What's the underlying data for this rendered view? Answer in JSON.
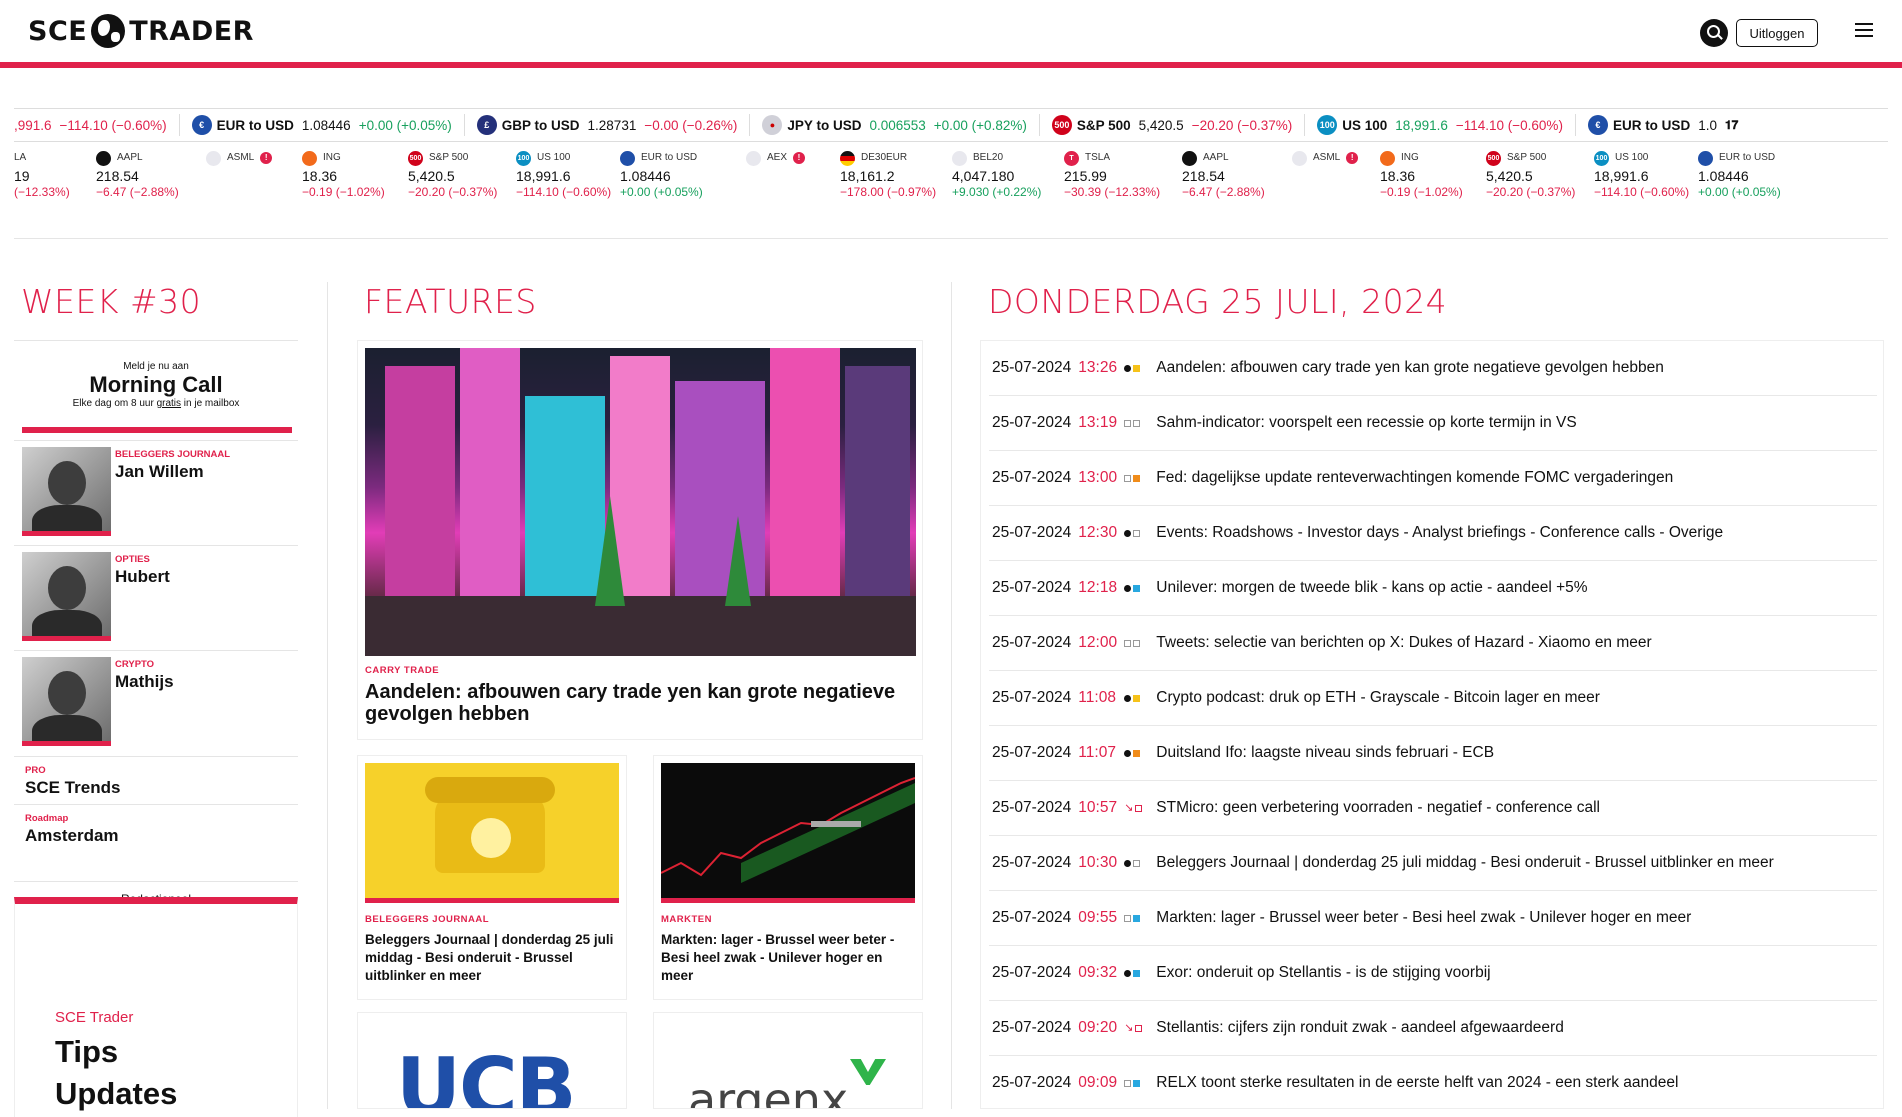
{
  "header": {
    "logo_left": "SCE",
    "logo_right": "TRADER",
    "logout_label": "Uitloggen"
  },
  "ticker_top": [
    {
      "sym": "",
      "price": ",991.6",
      "chg": "−114.10 (−0.60%)",
      "dir": "neg",
      "icon": ""
    },
    {
      "sym": "EUR to USD",
      "price": "1.08446",
      "chg": "+0.00 (+0.05%)",
      "dir": "pos",
      "icon": "flag-eu-us"
    },
    {
      "sym": "GBP to USD",
      "price": "1.28731",
      "chg": "−0.00 (−0.26%)",
      "dir": "neg",
      "icon": "flag-gb-us"
    },
    {
      "sym": "JPY to USD",
      "price": "0.006553",
      "chg": "+0.00 (+0.82%)",
      "dir": "pos",
      "icon": "flag-jp-us"
    },
    {
      "sym": "S&P 500",
      "price": "5,420.5",
      "chg": "−20.20 (−0.37%)",
      "dir": "neg",
      "icon": "500"
    },
    {
      "sym": "US 100",
      "price": "18,991.6",
      "chg": "−114.10 (−0.60%)",
      "dir": "neg",
      "icon": "100"
    },
    {
      "sym": "EUR to USD",
      "price": "1.0",
      "chg": "",
      "dir": "pos",
      "icon": "flag-eu-us"
    }
  ],
  "ticker_bottom": [
    {
      "name": "LA",
      "price": "19",
      "chg": "(−12.33%)",
      "dir": "neg"
    },
    {
      "name": "AAPL",
      "price": "218.54",
      "chg": "−6.47 (−2.88%)",
      "dir": "neg"
    },
    {
      "name": "ASML",
      "price": "",
      "chg": "",
      "dir": "neg"
    },
    {
      "name": "ING",
      "price": "18.36",
      "chg": "−0.19 (−1.02%)",
      "dir": "neg"
    },
    {
      "name": "S&P 500",
      "price": "5,420.5",
      "chg": "−20.20 (−0.37%)",
      "dir": "neg"
    },
    {
      "name": "US 100",
      "price": "18,991.6",
      "chg": "−114.10 (−0.60%)",
      "dir": "neg"
    },
    {
      "name": "EUR to USD",
      "price": "1.08446",
      "chg": "+0.00 (+0.05%)",
      "dir": "pos"
    },
    {
      "name": "AEX",
      "price": "",
      "chg": "",
      "dir": "neg"
    },
    {
      "name": "DE30EUR",
      "price": "18,161.2",
      "chg": "−178.00 (−0.97%)",
      "dir": "neg"
    },
    {
      "name": "BEL20",
      "price": "4,047.180",
      "chg": "+9.030 (+0.22%)",
      "dir": "pos"
    },
    {
      "name": "TSLA",
      "price": "215.99",
      "chg": "−30.39 (−12.33%)",
      "dir": "neg"
    },
    {
      "name": "AAPL",
      "price": "218.54",
      "chg": "−6.47 (−2.88%)",
      "dir": "neg"
    },
    {
      "name": "ASML",
      "price": "",
      "chg": "",
      "dir": "neg"
    },
    {
      "name": "ING",
      "price": "18.36",
      "chg": "−0.19 (−1.02%)",
      "dir": "neg"
    },
    {
      "name": "S&P 500",
      "price": "5,420.5",
      "chg": "−20.20 (−0.37%)",
      "dir": "neg"
    },
    {
      "name": "US 100",
      "price": "18,991.6",
      "chg": "−114.10 (−0.60%)",
      "dir": "neg"
    },
    {
      "name": "EUR to USD",
      "price": "1.08446",
      "chg": "+0.00 (+0.05%)",
      "dir": "pos"
    }
  ],
  "left": {
    "title": "WEEK #30",
    "mc_small": "Meld je nu aan",
    "mc_title": "Morning Call",
    "mc_sub_a": "Elke dag om 8 uur ",
    "mc_sub_u": "gratis",
    "mc_sub_b": " in je mailbox",
    "persons": [
      {
        "cat": "BELEGGERS JOURNAAL",
        "name": "Jan Willem"
      },
      {
        "cat": "OPTIES",
        "name": "Hubert"
      },
      {
        "cat": "CRYPTO",
        "name": "Mathijs"
      }
    ],
    "links": [
      {
        "cat": "PRO",
        "name": "SCE Trends"
      },
      {
        "cat": "Roadmap",
        "name": "Amsterdam"
      }
    ],
    "redac": "Redactioneel",
    "redac_brand": "SCE Trader",
    "redac_l1": "Tips",
    "redac_l2": "Updates"
  },
  "features": {
    "title": "FEATURES",
    "main": {
      "cat": "CARRY TRADE",
      "title": "Aandelen: afbouwen cary trade yen kan grote negatieve gevolgen hebben"
    },
    "small": [
      {
        "cat": "BELEGGERS JOURNAAL",
        "title": "Beleggers Journaal | donderdag 25 juli middag - Besi onderuit - Brussel uitblinker en meer"
      },
      {
        "cat": "MARKTEN",
        "title": "Markten: lager - Brussel weer beter - Besi heel zwak - Unilever hoger en meer"
      }
    ],
    "logos": [
      "UCB",
      "argenx"
    ]
  },
  "news": {
    "title": "DONDERDAG 25 JULI, 2024",
    "items": [
      {
        "date": "25-07-2024",
        "time": "13:26",
        "m1": "dot-black",
        "m2": "sq-yellow",
        "text": "Aandelen: afbouwen cary trade yen kan grote negatieve gevolgen hebben"
      },
      {
        "date": "25-07-2024",
        "time": "13:19",
        "m1": "sq-empty",
        "m2": "sq-empty",
        "text": "Sahm-indicator: voorspelt een recessie op korte termijn in VS"
      },
      {
        "date": "25-07-2024",
        "time": "13:00",
        "m1": "sq-empty",
        "m2": "sq-orange",
        "text": "Fed: dagelijkse update renteverwachtingen komende FOMC vergaderingen"
      },
      {
        "date": "25-07-2024",
        "time": "12:30",
        "m1": "dot-black",
        "m2": "sq-empty",
        "text": "Events: Roadshows - Investor days - Analyst briefings - Conference calls - Overige"
      },
      {
        "date": "25-07-2024",
        "time": "12:18",
        "m1": "dot-black",
        "m2": "sq-blue",
        "text": "Unilever: morgen de tweede blik - kans op actie - aandeel +5%"
      },
      {
        "date": "25-07-2024",
        "time": "12:00",
        "m1": "sq-empty",
        "m2": "sq-empty",
        "text": "Tweets: selectie van berichten op X: Dukes of Hazard - Xiaomo en meer"
      },
      {
        "date": "25-07-2024",
        "time": "11:08",
        "m1": "dot-black",
        "m2": "sq-yellow",
        "text": "Crypto podcast: druk op ETH - Grayscale - Bitcoin lager en meer"
      },
      {
        "date": "25-07-2024",
        "time": "11:07",
        "m1": "dot-black",
        "m2": "sq-orange",
        "text": "Duitsland Ifo: laagste niveau sinds februari - ECB"
      },
      {
        "date": "25-07-2024",
        "time": "10:57",
        "m1": "arrow-down",
        "m2": "sq-empty-red",
        "text": "STMicro: geen verbetering voorraden - negatief - conference call"
      },
      {
        "date": "25-07-2024",
        "time": "10:30",
        "m1": "dot-black",
        "m2": "sq-empty",
        "text": "Beleggers Journaal | donderdag 25 juli middag - Besi onderuit - Brussel uitblinker en meer"
      },
      {
        "date": "25-07-2024",
        "time": "09:55",
        "m1": "sq-empty",
        "m2": "sq-blue",
        "text": "Markten: lager - Brussel weer beter - Besi heel zwak - Unilever hoger en meer"
      },
      {
        "date": "25-07-2024",
        "time": "09:32",
        "m1": "dot-black",
        "m2": "sq-blue",
        "text": "Exor: onderuit op Stellantis - is de stijging voorbij"
      },
      {
        "date": "25-07-2024",
        "time": "09:20",
        "m1": "arrow-down",
        "m2": "sq-empty-red",
        "text": "Stellantis: cijfers zijn ronduit zwak - aandeel afgewaardeerd"
      },
      {
        "date": "25-07-2024",
        "time": "09:09",
        "m1": "sq-empty",
        "m2": "sq-blue",
        "text": "RELX toont sterke resultaten in de eerste helft van 2024 - een sterk aandeel"
      }
    ]
  },
  "colors": {
    "accent": "#e0214b",
    "positive": "#17a05d",
    "negative": "#e0214b"
  }
}
